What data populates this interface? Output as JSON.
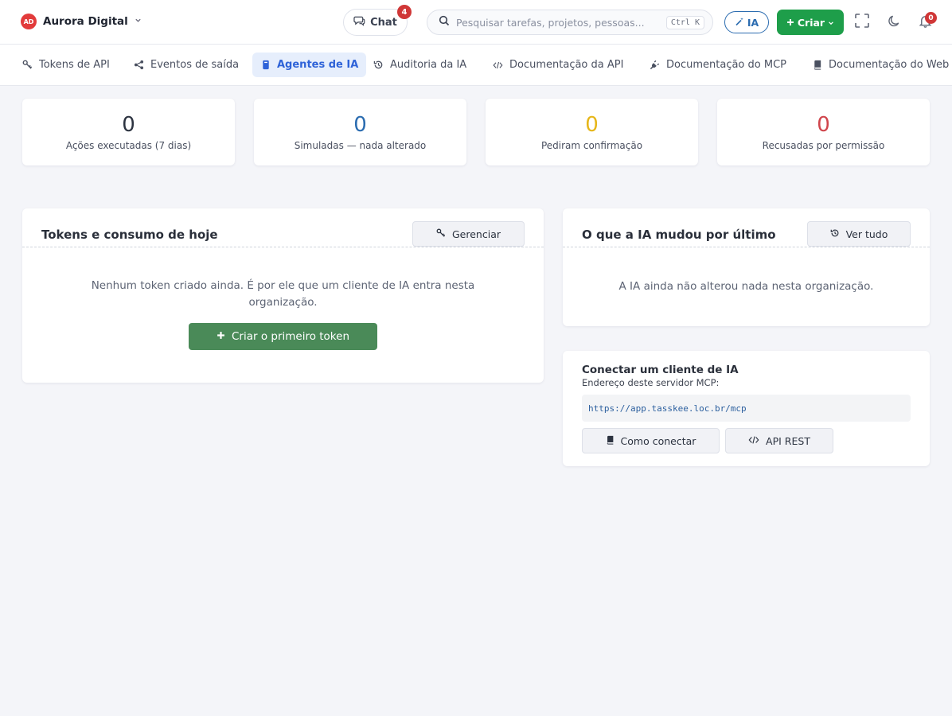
{
  "org": {
    "initials": "AD",
    "name": "Aurora Digital"
  },
  "topbar": {
    "chat_label": "Chat",
    "chat_count": "4",
    "search_placeholder": "Pesquisar tarefas, projetos, pessoas...",
    "search_shortcut": "Ctrl K",
    "ia_label": "IA",
    "create_label": "Criar",
    "notifications_count": "0"
  },
  "tabs": [
    {
      "label": "Tokens de API",
      "icon": "key-icon"
    },
    {
      "label": "Eventos de saída",
      "icon": "share-icon"
    },
    {
      "label": "Agentes de IA",
      "icon": "robot-icon",
      "active": true
    },
    {
      "label": "Auditoria da IA",
      "icon": "history-icon"
    },
    {
      "label": "Documentação da API",
      "icon": "code-icon"
    },
    {
      "label": "Documentação do MCP",
      "icon": "plug-icon"
    },
    {
      "label": "Documentação do Web",
      "icon": "book-icon"
    }
  ],
  "stats": [
    {
      "value": "0",
      "label": "Ações executadas (7 dias)",
      "color": "#2c3340"
    },
    {
      "value": "0",
      "label": "Simuladas — nada alterado",
      "color": "#2b6cb0"
    },
    {
      "value": "0",
      "label": "Pediram confirmação",
      "color": "#e6b619"
    },
    {
      "value": "0",
      "label": "Recusadas por permissão",
      "color": "#d0454c"
    }
  ],
  "tokens_panel": {
    "title": "Tokens e consumo de hoje",
    "manage_label": "Gerenciar",
    "empty_line1": "Nenhum token criado ainda. É por ele que um cliente de IA entra nesta",
    "empty_line2": "organização.",
    "create_token_label": "Criar o primeiro token"
  },
  "changes_panel": {
    "title": "O que a IA mudou por último",
    "view_all_label": "Ver tudo",
    "empty_text": "A IA ainda não alterou nada nesta organização."
  },
  "connect_panel": {
    "title": "Conectar um cliente de IA",
    "subtitle": "Endereço deste servidor MCP:",
    "url": "https://app.tasskee.loc.br/mcp",
    "how_label": "Como conectar",
    "api_label": "API REST"
  }
}
